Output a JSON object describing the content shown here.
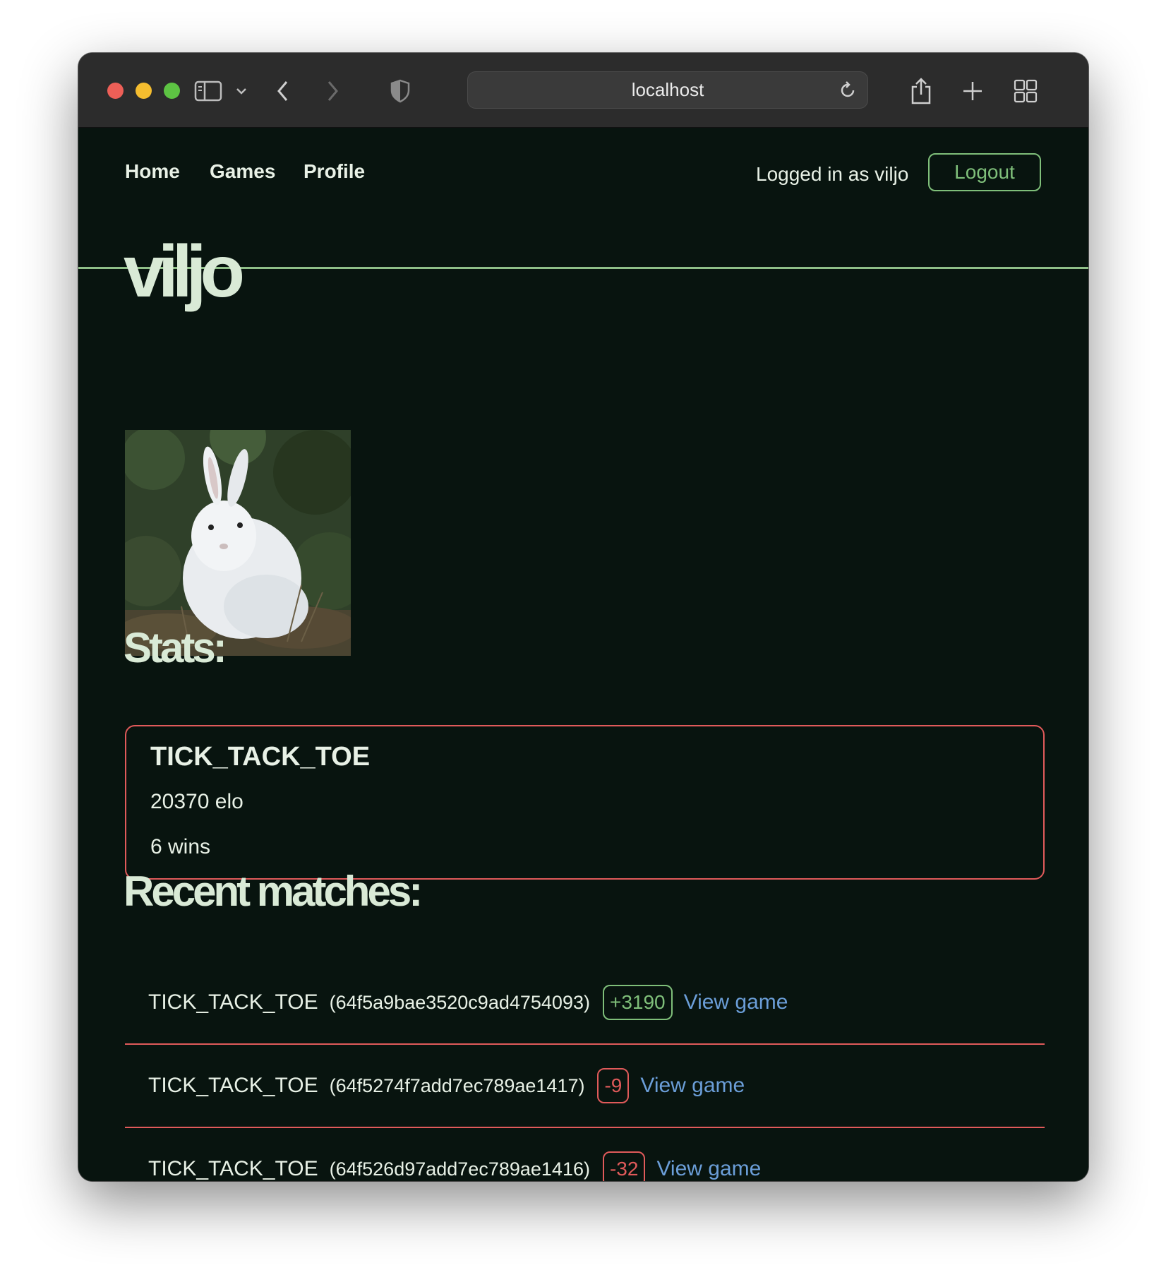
{
  "browser": {
    "url": "localhost",
    "icons": {
      "sidebar": "sidebar-icon",
      "back": "chevron-left-icon",
      "forward": "chevron-right-icon",
      "shield": "shield-icon",
      "reload": "reload-icon",
      "share": "share-icon",
      "new_tab": "plus-icon",
      "tabs": "grid-icon"
    }
  },
  "nav": {
    "home": "Home",
    "games": "Games",
    "profile": "Profile",
    "logged_in_text": "Logged in as viljo",
    "logout_label": "Logout"
  },
  "profile": {
    "username": "viljo",
    "avatar_alt": "white rabbit"
  },
  "stats": {
    "title": "Stats:",
    "game": "TICK_TACK_TOE",
    "elo": "20370 elo",
    "wins": "6 wins"
  },
  "recent": {
    "title": "Recent matches:",
    "matches": [
      {
        "game": "TICK_TACK_TOE",
        "id": "(64f5a9bae3520c9ad4754093)",
        "elo_change": "+3190",
        "link": "View game"
      },
      {
        "game": "TICK_TACK_TOE",
        "id": "(64f5274f7add7ec789ae1417)",
        "elo_change": "-9",
        "link": "View game"
      },
      {
        "game": "TICK_TACK_TOE",
        "id": "(64f526d97add7ec789ae1416)",
        "elo_change": "-32",
        "link": "View game"
      }
    ]
  },
  "colors": {
    "background": "#08140f",
    "accent_green": "#7fbf7a",
    "accent_red": "#e05a5a",
    "link_blue": "#6b9ed8",
    "heading": "#d9ead6"
  }
}
